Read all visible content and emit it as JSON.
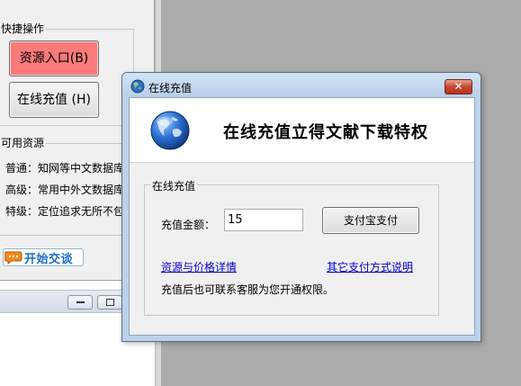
{
  "background_window": {
    "quick_ops_caption": "快捷操作",
    "resource_button_label": "资源入口(B)",
    "recharge_button_label": "在线充值 (H)",
    "available_caption": "可用资源",
    "resources": [
      "普通：知网等中文数据库",
      "高级：常用中外文数据库",
      "特级：定位追求无所不包"
    ],
    "chat_button_label": "开始交谈",
    "chat_icon": "speech-bubble-icon"
  },
  "dialog": {
    "title": "在线充值",
    "close_icon": "close-x-icon",
    "header_title": "在线充值立得文献下载特权",
    "header_icon": "globe-icon",
    "group_caption": "在线充值",
    "amount_label": "充值金额：",
    "amount_value": "15",
    "alipay_button_label": "支付宝支付",
    "link_pricing": "资源与价格详情",
    "link_other_payment": "其它支付方式说明",
    "note": "充值后也可联系客服为您开通权限。"
  },
  "colors": {
    "desktop": "#ababab",
    "resource_button": "#f97b7b",
    "link": "#0000cc",
    "close_button": "#c7452f",
    "chat_label": "#1a6ec8"
  }
}
